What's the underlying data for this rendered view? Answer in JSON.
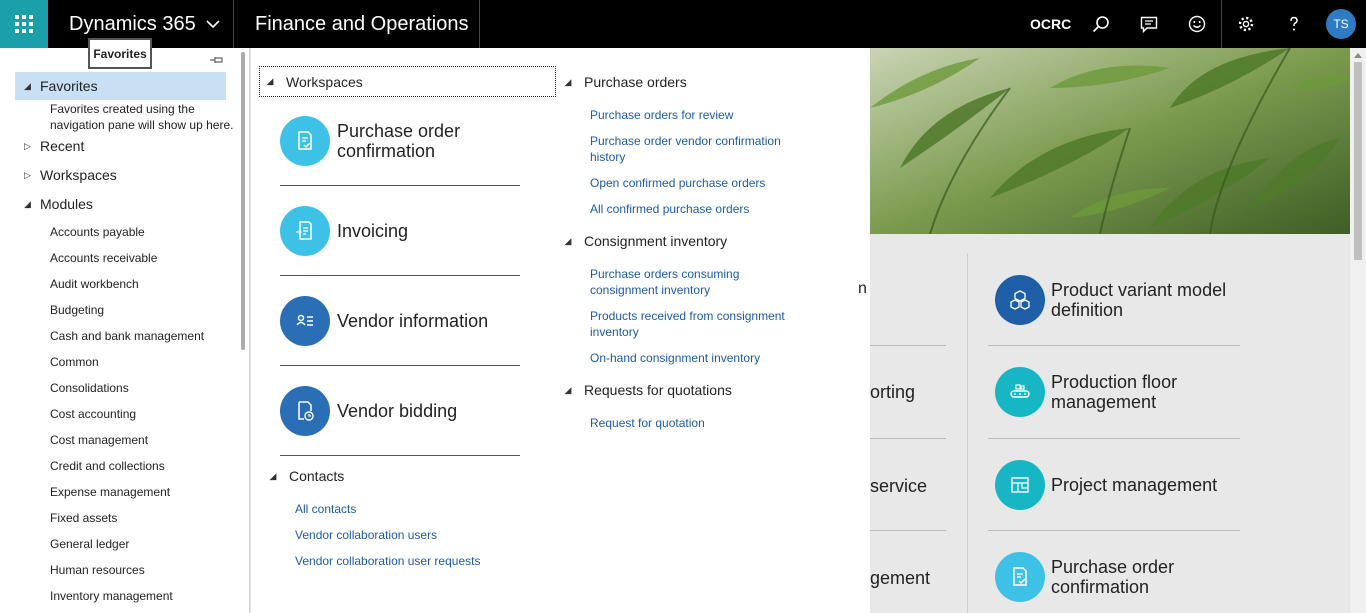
{
  "topbar": {
    "brand": "Dynamics 365",
    "app_name": "Finance and Operations",
    "company": "OCRC",
    "avatar_initials": "TS",
    "accent_color": "#1ba0a9"
  },
  "tooltip": {
    "text": "Favorites"
  },
  "nav": {
    "favorites_label": "Favorites",
    "favorites_note": "Favorites created using the navigation pane will show up here.",
    "recent_label": "Recent",
    "workspaces_label": "Workspaces",
    "modules_label": "Modules",
    "modules": [
      "Accounts payable",
      "Accounts receivable",
      "Audit workbench",
      "Budgeting",
      "Cash and bank management",
      "Common",
      "Consolidations",
      "Cost accounting",
      "Cost management",
      "Credit and collections",
      "Expense management",
      "Fixed assets",
      "General ledger",
      "Human resources",
      "Inventory management"
    ]
  },
  "flyout": {
    "workspaces_header": "Workspaces",
    "tiles": [
      {
        "label": "Purchase order confirmation",
        "icon": "document-check-icon",
        "color": "#3ec1e6"
      },
      {
        "label": "Invoicing",
        "icon": "invoice-icon",
        "color": "#3ec1e6"
      },
      {
        "label": "Vendor information",
        "icon": "contact-list-icon",
        "color": "#2a6fb5"
      },
      {
        "label": "Vendor bidding",
        "icon": "bid-clock-icon",
        "color": "#2a6fb5"
      }
    ],
    "contacts_header": "Contacts",
    "contacts_links": [
      "All contacts",
      "Vendor collaboration users",
      "Vendor collaboration user requests"
    ],
    "po_header": "Purchase orders",
    "po_links": [
      "Purchase orders for review",
      "Purchase order vendor confirmation history",
      "Open confirmed purchase orders",
      "All confirmed purchase orders"
    ],
    "consignment_header": "Consignment inventory",
    "consignment_links": [
      "Purchase orders consuming consignment inventory",
      "Products received from consignment inventory",
      "On-hand consignment inventory"
    ],
    "rfq_header": "Requests for quotations",
    "rfq_links": [
      "Request for quotation"
    ]
  },
  "background": {
    "left_fragments": [
      "n",
      "orting",
      "service",
      "gement"
    ],
    "tiles": [
      {
        "label": "Product variant model definition",
        "icon": "cubes-icon",
        "color": "#1f5fa8"
      },
      {
        "label": "Production floor management",
        "icon": "conveyor-icon",
        "color": "#17b6c4"
      },
      {
        "label": "Project management",
        "icon": "project-board-icon",
        "color": "#17b6c4"
      },
      {
        "label": "Purchase order confirmation",
        "icon": "document-check-icon",
        "color": "#3ec1e6"
      }
    ]
  }
}
